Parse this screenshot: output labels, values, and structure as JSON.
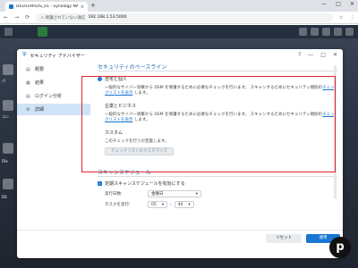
{
  "browser": {
    "tab_title": "DS1019PLUS_01 - Synology NAS",
    "tab_close": "×",
    "new_tab": "+",
    "win_min": "—",
    "win_max": "□",
    "win_close": "✕",
    "back": "←",
    "forward": "→",
    "reload": "⟳",
    "security_text": "⚠ 保護されていない通信",
    "url": "192.168.1.53:5000",
    "star": "☆",
    "menu": "⋮"
  },
  "desktop": {
    "labels": [
      "パ",
      "コン",
      "File",
      "DS"
    ]
  },
  "window": {
    "title": "セキュリティ アドバイザー",
    "ctl_help": "?",
    "ctl_min": "—",
    "ctl_max": "□",
    "ctl_close": "✕"
  },
  "sidebar": {
    "items": [
      {
        "icon": "▤",
        "label": "概要"
      },
      {
        "icon": "▦",
        "label": "結果"
      },
      {
        "icon": "▤",
        "label": "ログイン分析"
      },
      {
        "icon": "⚙",
        "label": "詳細"
      }
    ]
  },
  "baseline": {
    "section_title": "セキュリティのベースライン",
    "home": {
      "label": "自宅と個人",
      "desc": "一般的なサイバー攻撃から DSM を保護するために必要なチェックを行います。 スキャンするためにセキュリティ規則の",
      "link": "チェックリストを表示",
      "desc_end": " します。"
    },
    "business": {
      "label": "企業とビジネス",
      "desc": "一般的なサイバー攻撃から DSM を保護するために必要なチェックを行います。 スキャンするためにセキュリティ規則の",
      "link": "チェックリストを表示",
      "desc_end": " します。"
    },
    "custom": {
      "label": "カスタム",
      "desc": "このチェックを行うか定義します。",
      "button": "チェックリストのカスタマイズ"
    }
  },
  "schedule": {
    "section_title": "スキャンスケジュール",
    "enable_label": "定期スキャンスケジュールを有効にする",
    "run_day_label": "実行日数:",
    "run_day_value": "金曜日",
    "run_time_label": "タスクを実行:",
    "hour_value": "05",
    "minute_value": "40",
    "colon": ":"
  },
  "footer": {
    "reset": "リセット",
    "apply": "適用"
  },
  "colors": {
    "accent": "#1976d2",
    "highlight_box": "#e0242b"
  }
}
